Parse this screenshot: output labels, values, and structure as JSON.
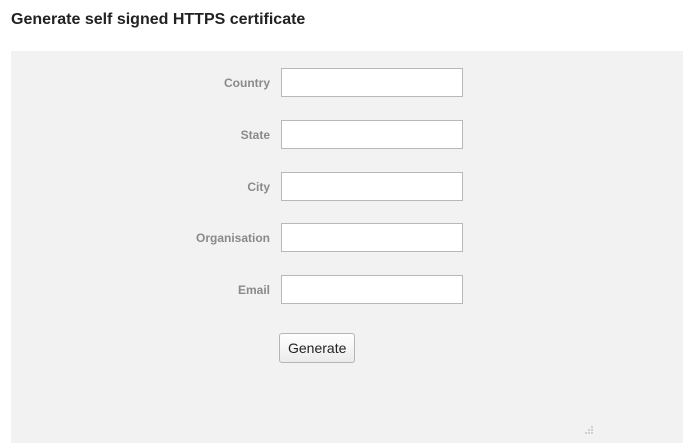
{
  "page": {
    "title": "Generate self signed HTTPS certificate"
  },
  "form": {
    "fields": [
      {
        "label": "Country",
        "value": ""
      },
      {
        "label": "State",
        "value": ""
      },
      {
        "label": "City",
        "value": ""
      },
      {
        "label": "Organisation",
        "value": ""
      },
      {
        "label": "Email",
        "value": ""
      }
    ],
    "submit_label": "Generate"
  },
  "icons": {
    "resize_handle": "resize-grip-icon"
  },
  "colors": {
    "panel_background": "#f2f2f2",
    "label_text": "#8a8a8a",
    "title_text": "#222222"
  }
}
